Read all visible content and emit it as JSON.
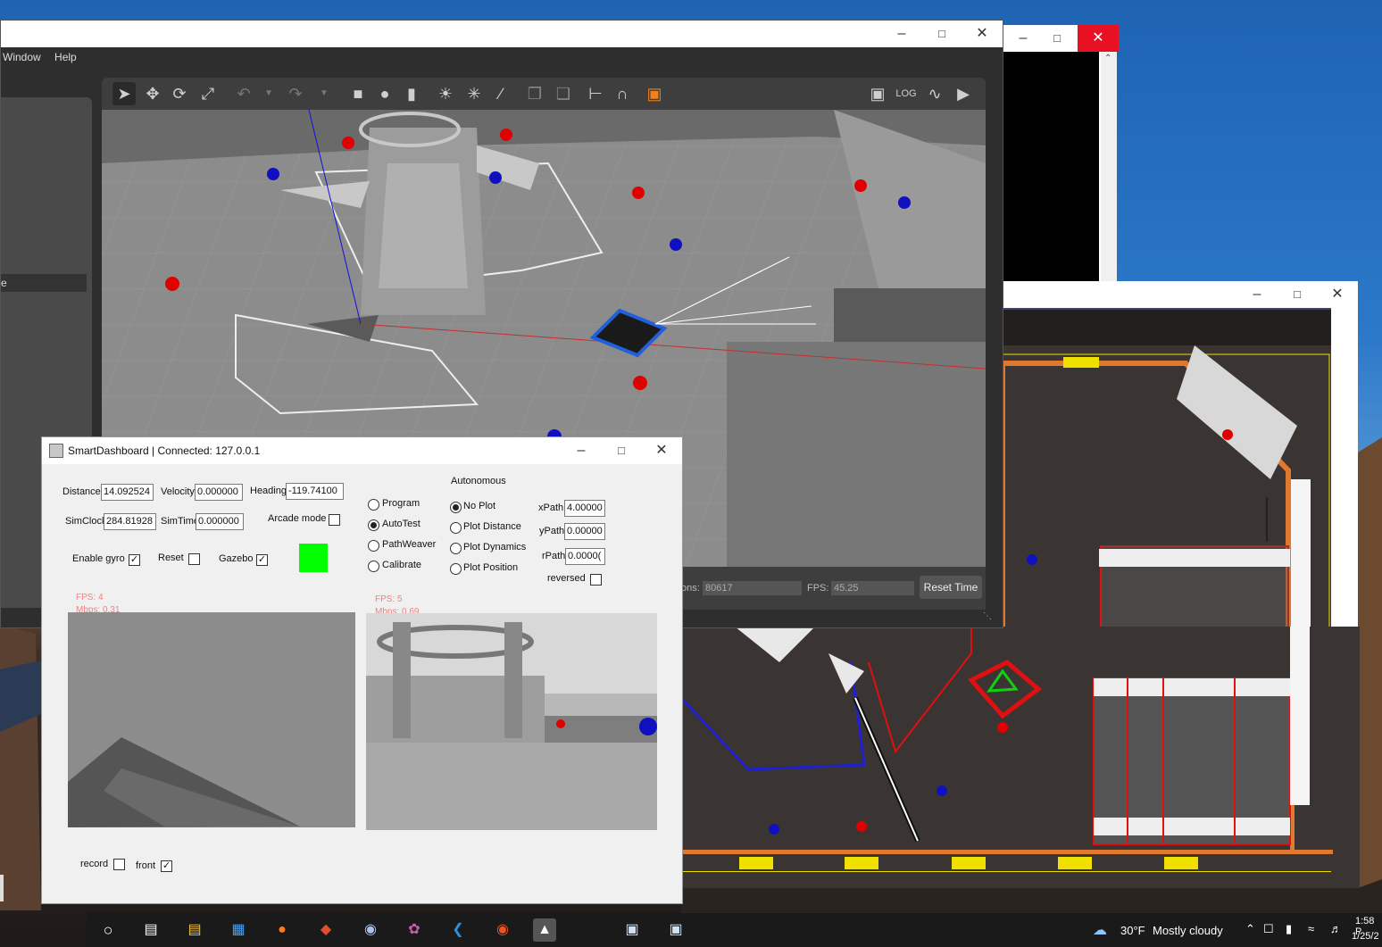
{
  "gazebo": {
    "menu": [
      "Window",
      "Help"
    ],
    "status": {
      "iterations_label": "ons:",
      "iterations_value": "80617",
      "fps_label": "FPS:",
      "fps_value": "45.25",
      "reset_label": "Reset Time"
    },
    "left_panel_selected": "e",
    "toolbar_icons": [
      "select-icon",
      "translate-icon",
      "rotate-icon",
      "scale-icon",
      "undo-icon",
      "undo-menu-icon",
      "redo-icon",
      "redo-menu-icon",
      "box-icon",
      "sphere-icon",
      "cylinder-icon",
      "point-light-icon",
      "spot-light-icon",
      "directional-light-icon",
      "copy-icon",
      "paste-icon",
      "align-icon",
      "snap-icon",
      "view-angle-icon",
      "screenshot-icon",
      "log-icon",
      "plot-icon",
      "record-video-icon"
    ]
  },
  "smartdashboard": {
    "title": "SmartDashboard | Connected: 127.0.0.1",
    "distance_label": "Distance",
    "distance_value": "14.092524",
    "velocity_label": "Velocity",
    "velocity_value": "0.000000",
    "heading_label": "Heading",
    "heading_value": "-119.74100",
    "simclock_label": "SimClock",
    "simclock_value": "284.81928",
    "simtime_label": "SimTime",
    "simtime_value": "0.000000",
    "arcade_label": "Arcade mode",
    "enable_gyro_label": "Enable gyro",
    "reset_label": "Reset",
    "gazebo_label": "Gazebo",
    "indicator_color": "#00ff00",
    "program_options": [
      "Program",
      "AutoTest",
      "PathWeaver",
      "Calibrate"
    ],
    "program_selected": "AutoTest",
    "autonomous_label": "Autonomous",
    "plot_options": [
      "No Plot",
      "Plot Distance",
      "Plot Dynamics",
      "Plot Position"
    ],
    "plot_selected": "No Plot",
    "xpath_label": "xPath",
    "xpath_value": "4.00000",
    "ypath_label": "yPath",
    "ypath_value": "0.00000",
    "rpath_label": "rPath",
    "rpath_value": "0.0000(",
    "reversed_label": "reversed",
    "cam1_fps": "FPS: 4",
    "cam1_mbps": "Mbps: 0.31",
    "cam2_fps": "FPS: 5",
    "cam2_mbps": "Mbps: 0.69",
    "record_label": "record",
    "front_label": "front",
    "checks": {
      "enable_gyro": true,
      "reset": false,
      "gazebo": true,
      "arcade": false,
      "reversed": false,
      "record": false,
      "front": true
    }
  },
  "taskbar": {
    "icons": [
      "cortana-icon",
      "task-view-icon",
      "file-explorer-icon",
      "store-icon",
      "firefox-icon",
      "git-icon",
      "camera-icon",
      "paint-icon",
      "vscode-icon",
      "ubuntu-icon",
      "java-app-icon",
      "window-icon-1",
      "window-icon-2"
    ],
    "weather_temp": "30°F",
    "weather_desc": "Mostly cloudy",
    "time": "1:58 P",
    "date": "1/25/2"
  },
  "colors": {
    "red_ball": "#e00000",
    "blue_ball": "#1010c0",
    "field_orange": "#e07830",
    "field_red": "#e01010",
    "field_blue": "#2020d0",
    "field_yellow": "#f0e000"
  }
}
